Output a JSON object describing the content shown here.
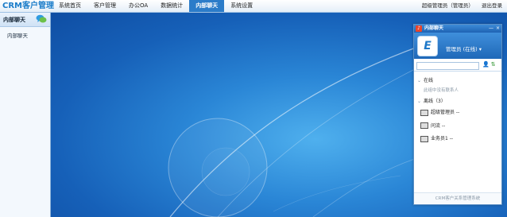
{
  "app": {
    "logo": "CRM客户管理"
  },
  "nav": {
    "items": [
      {
        "label": "系统首页"
      },
      {
        "label": "客户管理"
      },
      {
        "label": "办公OA"
      },
      {
        "label": "数据统计"
      },
      {
        "label": "内部聊天"
      },
      {
        "label": "系统设置"
      }
    ],
    "active_index": 4
  },
  "user_area": {
    "user": "超级管理员（管理员）",
    "logout": "退出登录"
  },
  "sidebar": {
    "title": "内部聊天",
    "items": [
      {
        "label": "内部聊天"
      }
    ]
  },
  "chat": {
    "title": "内部聊天",
    "title_icon_glyph": "♪",
    "window_buttons": [
      "—",
      "×"
    ],
    "avatar_letter": "E",
    "name": "管理员",
    "status": "(在线)",
    "dropdown_glyph": "▾",
    "add_contact_glyph": "👤",
    "sort_glyph": "⇅",
    "groups": {
      "online": {
        "label": "在线",
        "empty_note": "此组中没有联系人"
      },
      "offline": {
        "label": "离线（3）",
        "members": [
          "超级管理员 --",
          "问流 --",
          "业务员1 --"
        ]
      }
    },
    "footer": "CRM客户关系管理系统"
  },
  "colors": {
    "accent": "#2b7cc9",
    "desktop": "#1e6fc5",
    "logo": "#1a7cc9"
  }
}
